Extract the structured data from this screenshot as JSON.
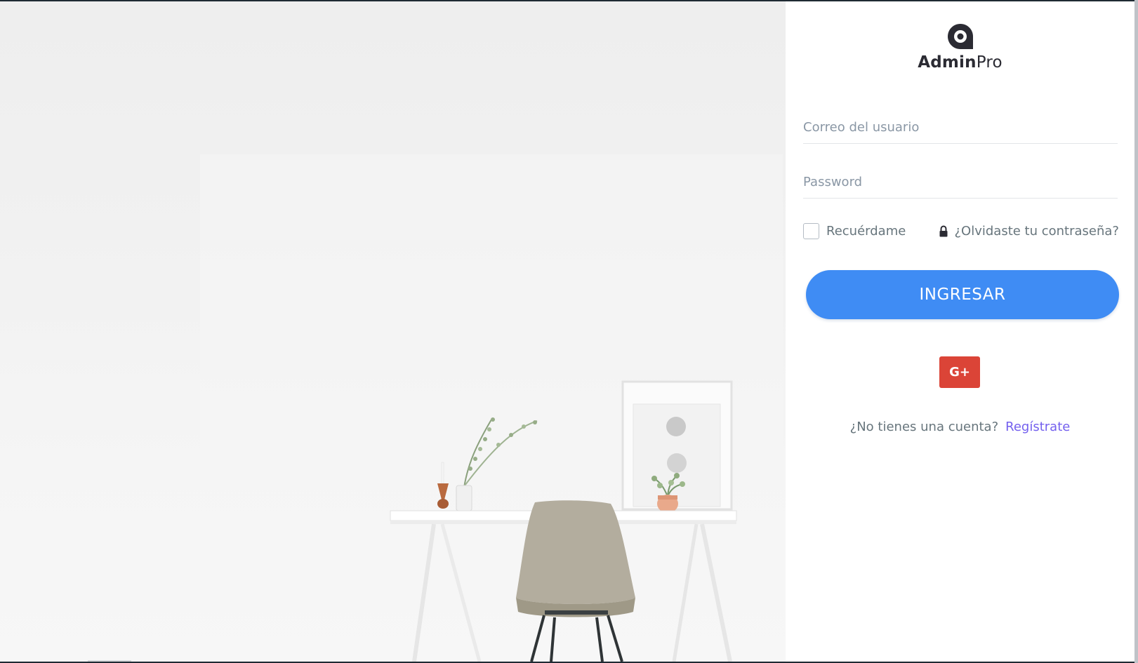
{
  "brand": {
    "name_strong": "Admin",
    "name_light": "Pro",
    "logo_icon": "admin-pro-logo-icon"
  },
  "form": {
    "email_placeholder": "Correo del usuario",
    "password_placeholder": "Password",
    "remember_label": "Recuérdame",
    "forgot_label": "¿Olvidaste tu contraseña?",
    "login_label": "INGRESAR",
    "google_label": "G+",
    "no_account_text": "¿No tienes una cuenta?",
    "signup_label": "Regístrate"
  },
  "colors": {
    "primary": "#3f8cf4",
    "google": "#db4437",
    "link": "#7460ee",
    "text": "#67757c"
  }
}
